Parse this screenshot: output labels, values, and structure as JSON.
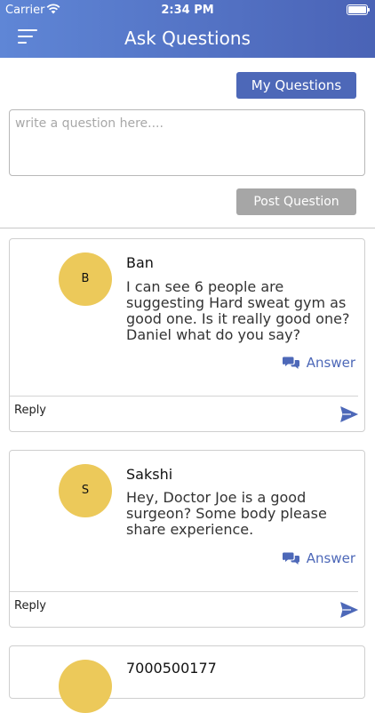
{
  "status_bar": {
    "carrier": "Carrier",
    "time": "2:34 PM"
  },
  "header": {
    "title": "Ask Questions",
    "menu_icon": "hamburger-menu-icon"
  },
  "actions": {
    "my_questions": "My Questions",
    "post_question": "Post Question",
    "question_placeholder": "write a question here...."
  },
  "colors": {
    "header_gradient_start": "#5f86d6",
    "header_gradient_end": "#4a63b6",
    "accent": "#4d68b8",
    "disabled_button": "#a6a6a6",
    "avatar": "#ecc95a"
  },
  "questions": [
    {
      "initial": "B",
      "name": "Ban",
      "text": "I can see 6 people are suggesting Hard sweat gym as good one. Is it really good one?  Daniel what do you say?",
      "answer_label": "Answer",
      "reply_placeholder": "Reply"
    },
    {
      "initial": "S",
      "name": "Sakshi",
      "text": "Hey, Doctor Joe is a good surgeon? Some body please share experience.",
      "answer_label": "Answer",
      "reply_placeholder": "Reply"
    },
    {
      "initial": "",
      "name": "7000500177"
    }
  ]
}
